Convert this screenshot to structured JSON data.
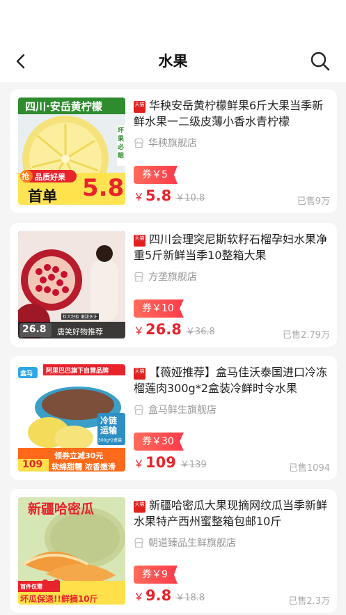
{
  "header": {
    "title": "水果"
  },
  "icons": {
    "back": "chevron-left-icon",
    "search": "search-icon",
    "store": "store-icon",
    "tmall": "tmall-icon"
  },
  "colors": {
    "accent_red": "#e8232c",
    "coupon_gradient_start": "#ff6b5b",
    "coupon_gradient_end": "#ff3b4b",
    "muted_text": "#999999"
  },
  "products": [
    {
      "title": "华秧安岳黄柠檬鲜果6斤大果当季新鲜水果一二级皮薄小香水青柠檬",
      "store": "华秧旗舰店",
      "coupon": "券￥5",
      "price_symbol": "￥",
      "price": "5.8",
      "original_price": "￥10.8",
      "sold": "已售9万",
      "badge": "天猫",
      "image_text": {
        "banner": "四川·安岳黄柠檬",
        "side": "坏果必赔",
        "tag": "品质好果",
        "grab": "抢",
        "first": "首单",
        "price": "5.8"
      }
    },
    {
      "title": "四川会理突尼斯软籽石榴孕妇水果净重5斤新鲜当季10整箱大果",
      "store": "方垄旗舰店",
      "coupon": "券￥10",
      "price_symbol": "￥",
      "price": "26.8",
      "original_price": "￥36.8",
      "sold": "已售2.79万",
      "badge": "天猫",
      "image_text": {
        "price": "26.8",
        "caption": "唐笑好物推荐",
        "small": "粒大籽软 嫩甜多汁"
      }
    },
    {
      "title": "【薇娅推荐】盒马佳沃泰国进口冷冻榴莲肉300g*2盒装冷鲜时令水果",
      "store": "盒马鲜生旗舰店",
      "coupon": "券￥30",
      "price_symbol": "￥",
      "price": "109",
      "original_price": "￥139",
      "sold": "已售1094",
      "badge": "天猫",
      "image_text": {
        "top": "阿里巴巴旗下自营品牌",
        "logo": "盒马",
        "cold": "冷链运输",
        "spec": "300g*2盒装",
        "price": "109",
        "coupon": "领券立减30元",
        "slogan": "软绵甜糯 浓香嫩滑"
      }
    },
    {
      "title": "新疆哈密瓜大果现摘网纹瓜当季新鲜水果特产西州蜜整箱包邮10斤",
      "store": "朝道臻品生鲜旗舰店",
      "coupon": "券￥9",
      "price_symbol": "￥",
      "price": "9.8",
      "original_price": "￥18.8",
      "sold": "已售2.3万",
      "badge": "天猫",
      "image_text": {
        "banner": "新疆哈密瓜",
        "first": "首件仅需",
        "price": "9.8",
        "guarantee": "坏瓜保退!!鲜摘10斤"
      }
    }
  ]
}
